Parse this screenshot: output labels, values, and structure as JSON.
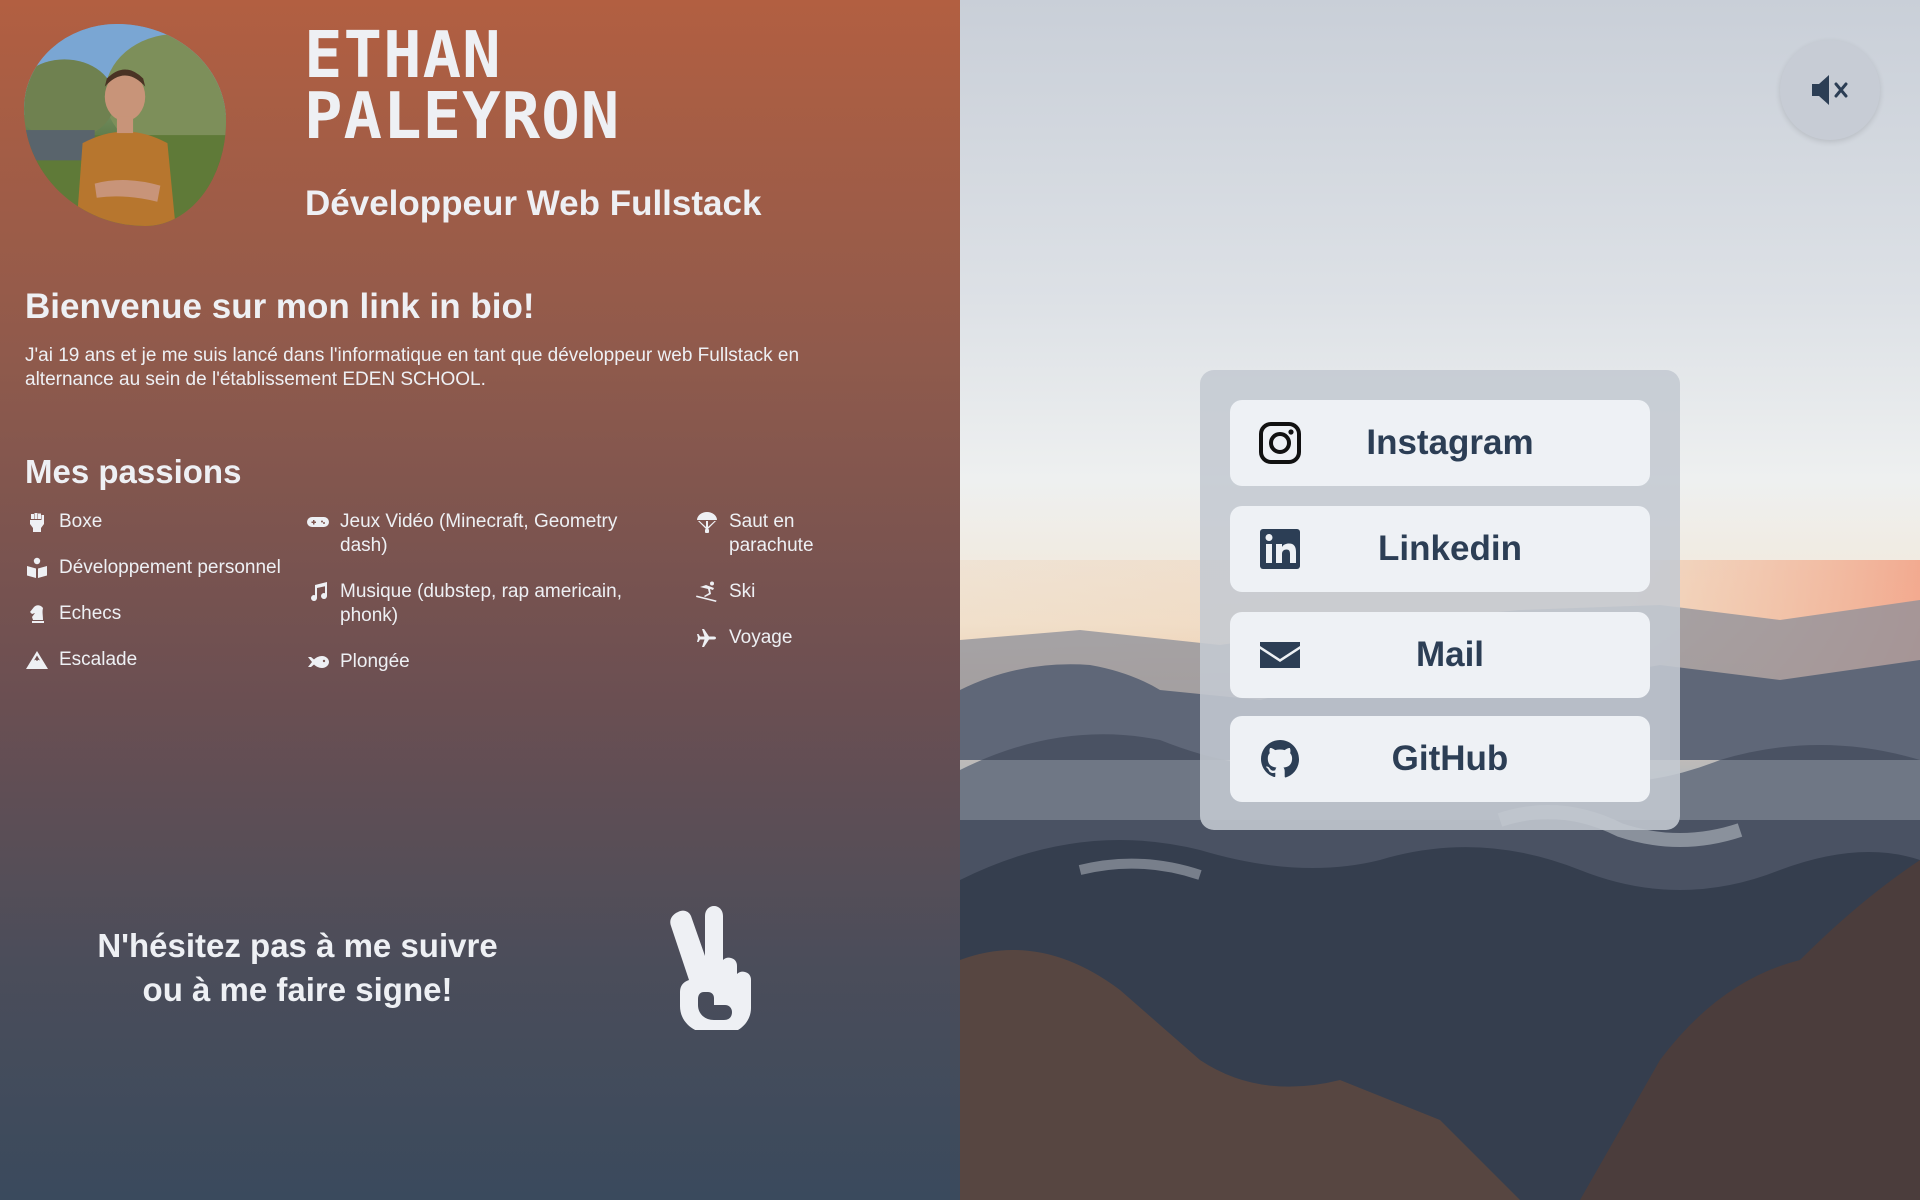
{
  "profile": {
    "first_name": "ETHAN",
    "last_name": "PALEYRON",
    "role": "Développeur Web Fullstack",
    "avatar_icon": "profile-photo"
  },
  "welcome": {
    "title": "Bienvenue sur mon link in bio!",
    "text": "J'ai 19 ans et je me suis lancé dans l'informatique en tant que développeur web Fullstack en alternance au sein de l'établissement EDEN SCHOOL."
  },
  "passions": {
    "title": "Mes passions",
    "columns": [
      [
        {
          "label": "Boxe",
          "icon": "fist-icon"
        },
        {
          "label": "Développement personnel",
          "icon": "book-reader-icon"
        },
        {
          "label": "Echecs",
          "icon": "chess-knight-icon"
        },
        {
          "label": "Escalade",
          "icon": "mountain-icon"
        }
      ],
      [
        {
          "label": "Jeux Vidéo (Minecraft, Geometry dash)",
          "icon": "gamepad-icon"
        },
        {
          "label": "Musique (dubstep, rap americain, phonk)",
          "icon": "music-icon"
        },
        {
          "label": "Plongée",
          "icon": "fish-icon"
        }
      ],
      [
        {
          "label": "Saut en parachute",
          "icon": "parachute-icon"
        },
        {
          "label": "Ski",
          "icon": "skiing-icon"
        },
        {
          "label": "Voyage",
          "icon": "plane-icon"
        }
      ]
    ]
  },
  "follow": {
    "line1": "N'hésitez pas à me suivre",
    "line2": "ou à me faire signe!",
    "icon": "peace-hand-icon"
  },
  "audio": {
    "icon": "volume-mute-icon"
  },
  "links": [
    {
      "label": "Instagram",
      "icon": "instagram-icon"
    },
    {
      "label": "Linkedin",
      "icon": "linkedin-icon"
    },
    {
      "label": "Mail",
      "icon": "envelope-icon"
    },
    {
      "label": "GitHub",
      "icon": "github-icon"
    }
  ],
  "colors": {
    "text_light": "#eef0f4",
    "link_text": "#2c3e55",
    "link_button_bg": "#eef1f5",
    "gradient_top": "#b25f41",
    "gradient_bottom": "#3a4a5d"
  }
}
